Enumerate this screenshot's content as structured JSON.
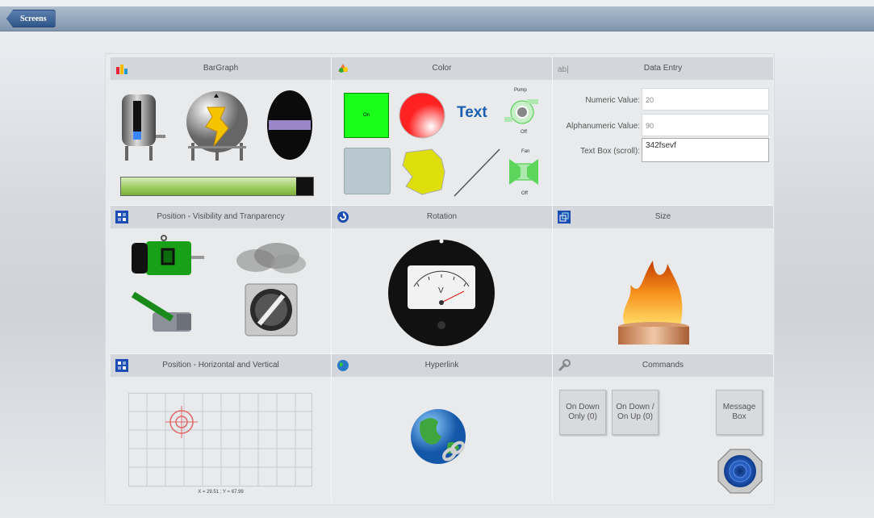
{
  "topbar": {
    "screens_label": "Screens"
  },
  "panels": {
    "bargraph": {
      "title": "BarGraph"
    },
    "color": {
      "title": "Color",
      "on_label": "On",
      "text_label": "Text",
      "pump_label": "Pump",
      "pump_state": "Off",
      "fan_label": "Fan",
      "fan_state": "Off"
    },
    "data_entry": {
      "title": "Data Entry",
      "numeric_label": "Numeric Value:",
      "numeric_value": "20",
      "alpha_label": "Alphanumeric Value:",
      "alpha_value": "90",
      "textbox_label": "Text Box (scroll):",
      "textbox_value": "342fsevf"
    },
    "position_vis": {
      "title": "Position - Visibility and Tranparency"
    },
    "rotation": {
      "title": "Rotation"
    },
    "size": {
      "title": "Size"
    },
    "position_hv": {
      "title": "Position - Horizontal and Vertical",
      "coords": "X = 29.51 ; Y = 67.99"
    },
    "hyperlink": {
      "title": "Hyperlink"
    },
    "commands": {
      "title": "Commands",
      "btn_on_down": "On Down Only (0)",
      "btn_on_down_up": "On Down / On Up (0)",
      "btn_message": "Message Box"
    }
  },
  "colors": {
    "on_green": "#1aff1a",
    "text_blue": "#1a5fb0",
    "bar_green": "#a8d46a"
  },
  "bargraph_level": 0.91
}
